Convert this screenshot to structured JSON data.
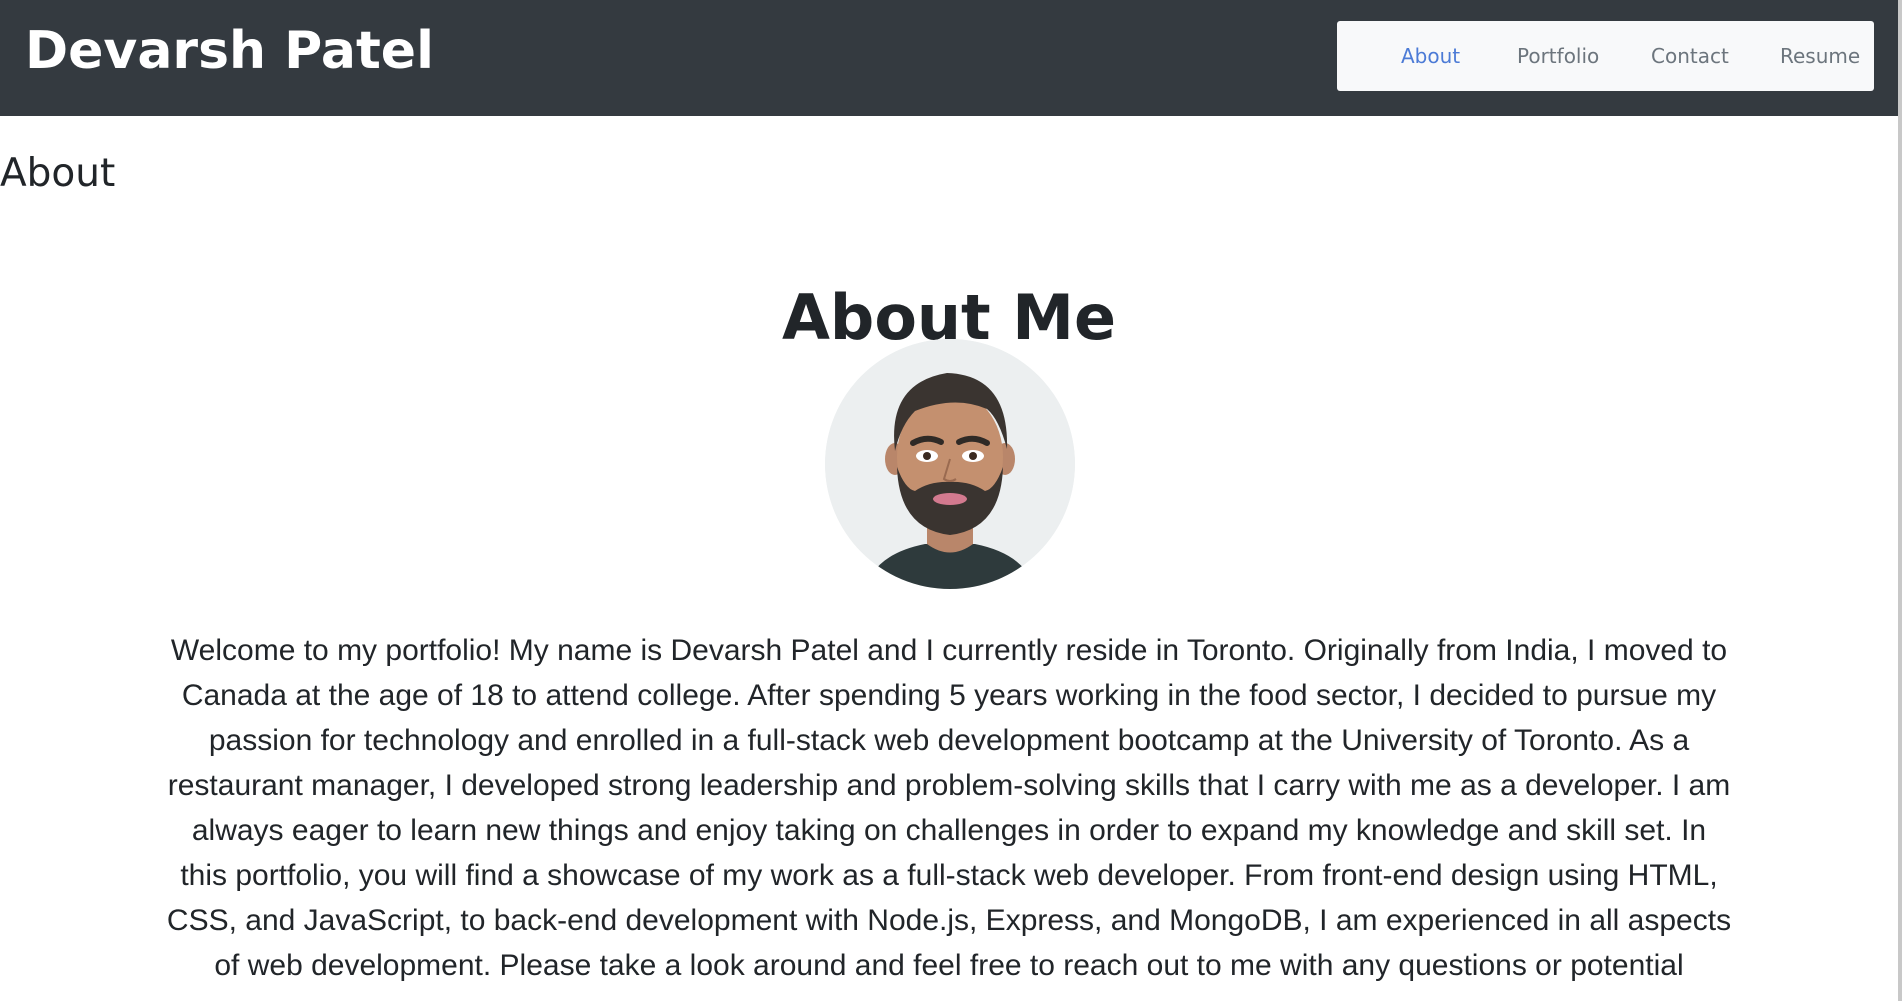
{
  "header": {
    "brand": "Devarsh Patel",
    "nav": {
      "about": "About",
      "portfolio": "Portfolio",
      "contact": "Contact",
      "resume": "Resume",
      "active": "About"
    }
  },
  "main": {
    "section_heading": "About",
    "title": "About Me",
    "avatar_icon": "avatar-illustration-icon",
    "bio": "Welcome to my portfolio! My name is Devarsh Patel and I currently reside in Toronto. Originally from India, I moved to Canada at the age of 18 to attend college. After spending 5 years working in the food sector, I decided to pursue my passion for technology and enrolled in a full-stack web development bootcamp at the University of Toronto. As a restaurant manager, I developed strong leadership and problem-solving skills that I carry with me as a developer. I am always eager to learn new things and enjoy taking on challenges in order to expand my knowledge and skill set. In this portfolio, you will find a showcase of my work as a full-stack web developer. From front-end design using HTML, CSS, and JavaScript, to back-end development with Node.js, Express, and MongoDB, I am experienced in all aspects of web development. Please take a look around and feel free to reach out to me with any questions or potential"
  },
  "colors": {
    "header_bg": "#343a40",
    "nav_bg": "#f8f9fa",
    "nav_active": "#4c7bd6",
    "nav_inactive": "#6c757d",
    "text": "#212529"
  }
}
